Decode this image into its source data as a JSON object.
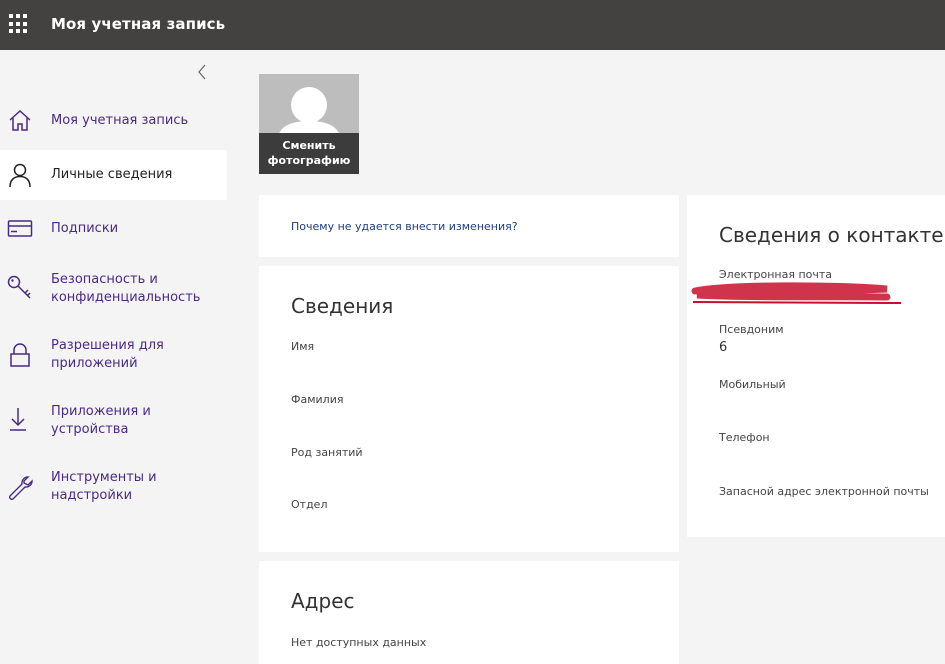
{
  "header": {
    "title": "Моя учетная запись"
  },
  "sidebar": {
    "items": [
      {
        "label": "Моя учетная запись",
        "icon": "home-icon"
      },
      {
        "label": "Личные сведения",
        "icon": "person-icon"
      },
      {
        "label": "Подписки",
        "icon": "card-icon"
      },
      {
        "label": "Безопасность и конфиденциальность",
        "icon": "key-icon"
      },
      {
        "label": "Разрешения для приложений",
        "icon": "lock-icon"
      },
      {
        "label": "Приложения и устройства",
        "icon": "download-icon"
      },
      {
        "label": "Инструменты и надстройки",
        "icon": "wrench-icon"
      }
    ]
  },
  "photo": {
    "change_label": "Сменить фотографию"
  },
  "help": {
    "link": "Почему не удается внести изменения?"
  },
  "details": {
    "title": "Сведения",
    "fields": [
      "Имя",
      "Фамилия",
      "Род занятий",
      "Отдел"
    ]
  },
  "address": {
    "title": "Адрес",
    "empty": "Нет доступных данных"
  },
  "contact": {
    "title": "Сведения о контакте",
    "email_label": "Электронная почта",
    "alias_label": "Псевдоним",
    "alias_value": "6",
    "mobile_label": "Мобильный",
    "phone_label": "Телефон",
    "alt_email_label": "Запасной адрес электронной почты"
  },
  "colors": {
    "topbar": "#444240",
    "link": "#4b2a84",
    "redaction": "#c8102e"
  }
}
